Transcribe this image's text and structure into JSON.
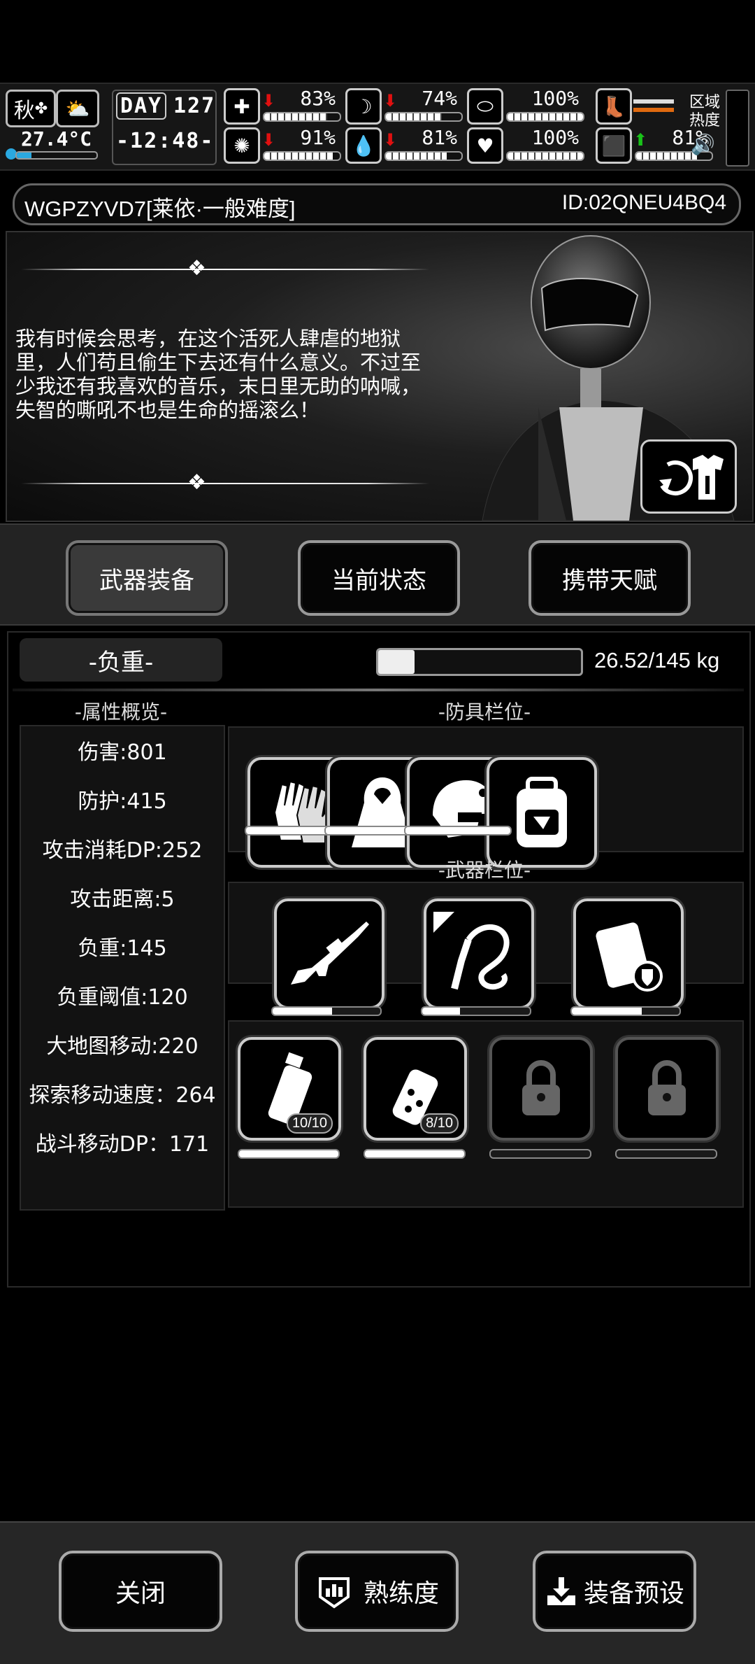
{
  "hud": {
    "season": "秋",
    "temperature": "27.4°C",
    "temperature_level": 0.18,
    "day_label": "DAY",
    "day_number": "127",
    "time": "-12:48-",
    "stats": [
      {
        "icon": "medkit-icon",
        "value": "83%",
        "trend": "down",
        "level": 0.83
      },
      {
        "icon": "stomach-icon",
        "value": "74%",
        "trend": "down",
        "level": 0.74
      },
      {
        "icon": "shield-badge-icon",
        "value": "100%",
        "trend": "none",
        "level": 1.0
      },
      {
        "icon": "brain-icon",
        "value": "91%",
        "trend": "down",
        "level": 0.91
      },
      {
        "icon": "water-drop-icon",
        "value": "81%",
        "trend": "down",
        "level": 0.81
      },
      {
        "icon": "heart-icon",
        "value": "100%",
        "trend": "none",
        "level": 1.0
      },
      {
        "icon": "boot-icon",
        "value": "81%",
        "trend": "up",
        "level": 0.81
      }
    ],
    "zone_heat_label": "区域\n热度",
    "colors": {
      "down": "#e01010",
      "up": "#19c219"
    }
  },
  "character": {
    "name": "WGPZYVD7[莱依·一般难度]",
    "id": "ID:02QNEU4BQ4",
    "quote": "我有时候会思考，在这个活死人肆虐的地狱里，人们苟且偷生下去还有什么意义。不过至少我还有我喜欢的音乐，末日里无助的呐喊，失智的嘶吼不也是生命的摇滚么！"
  },
  "tabs": [
    {
      "label": "武器装备",
      "active": true
    },
    {
      "label": "当前状态",
      "active": false
    },
    {
      "label": "携带天赋",
      "active": false
    }
  ],
  "weight": {
    "label": "-负重-",
    "text": "26.52/145 kg",
    "level": 0.18
  },
  "attributes": {
    "title": "-属性概览-",
    "items": [
      "伤害:801",
      "防护:415",
      "攻击消耗DP:252",
      "攻击距离:5",
      "负重:145",
      "负重阈值:120",
      "大地图移动:220",
      "探索移动速度：264",
      "战斗移动DP：171"
    ]
  },
  "armor": {
    "title": "-防具栏位-",
    "slots": [
      {
        "icon": "gloves-icon",
        "durability": 1.0
      },
      {
        "icon": "cloak-icon",
        "durability": 1.0
      },
      {
        "icon": "helmet-icon",
        "durability": 1.0
      },
      {
        "icon": "backpack-icon",
        "durability": null
      }
    ]
  },
  "weapons": {
    "title": "-武器栏位-",
    "slots": [
      {
        "icon": "sniper-rifle-icon",
        "durability": 0.55
      },
      {
        "icon": "bone-whip-icon",
        "durability": 0.35
      },
      {
        "icon": "riot-shield-icon",
        "durability": 0.65
      }
    ]
  },
  "throwables": {
    "slots": [
      {
        "icon": "grenade-icon",
        "count": "10/10",
        "durability": 1.0,
        "locked": false
      },
      {
        "icon": "flashbang-icon",
        "count": "8/10",
        "durability": 1.0,
        "locked": false
      },
      {
        "icon": "lock-icon",
        "count": "",
        "durability": 0,
        "locked": true
      },
      {
        "icon": "lock-icon",
        "count": "",
        "durability": 0,
        "locked": true
      }
    ]
  },
  "bottom": {
    "close": "关闭",
    "proficiency": "熟练度",
    "preset": "装备预设"
  }
}
